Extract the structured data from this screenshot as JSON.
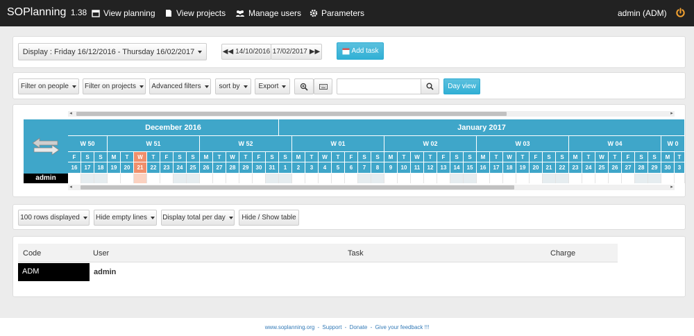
{
  "app": {
    "name": "SOPlanning",
    "version": "1.38"
  },
  "nav": [
    {
      "label": "View planning",
      "icon": "calendar-icon"
    },
    {
      "label": "View projects",
      "icon": "file-icon"
    },
    {
      "label": "Manage users",
      "icon": "users-icon"
    },
    {
      "label": "Parameters",
      "icon": "gear-icon"
    }
  ],
  "user_menu": "admin (ADM)",
  "toolbar1": {
    "display_label": "Display : Friday 16/12/2016 - Thursday 16/02/2017",
    "prev_date": "14/10/2016",
    "next_date": "17/02/2017",
    "add_task": "Add task"
  },
  "toolbar2": {
    "filter_people": "Filter on people",
    "filter_projects": "Filter on projects",
    "advanced_filters": "Advanced filters",
    "sort_by": "sort by",
    "export": "Export",
    "search_placeholder": "",
    "day_view": "Day view"
  },
  "planning": {
    "months": [
      {
        "label": "December 2016"
      },
      {
        "label": "January 2017"
      }
    ],
    "weeks": [
      "W 50",
      "W 51",
      "W 52",
      "W 01",
      "W 02",
      "W 03",
      "W 04",
      "W 0"
    ],
    "days": [
      {
        "dow": "F",
        "dom": "16"
      },
      {
        "dow": "S",
        "dom": "17"
      },
      {
        "dow": "S",
        "dom": "18"
      },
      {
        "dow": "M",
        "dom": "19"
      },
      {
        "dow": "T",
        "dom": "20"
      },
      {
        "dow": "W",
        "dom": "21"
      },
      {
        "dow": "T",
        "dom": "22"
      },
      {
        "dow": "F",
        "dom": "23"
      },
      {
        "dow": "S",
        "dom": "24"
      },
      {
        "dow": "S",
        "dom": "25"
      },
      {
        "dow": "M",
        "dom": "26"
      },
      {
        "dow": "T",
        "dom": "27"
      },
      {
        "dow": "W",
        "dom": "28"
      },
      {
        "dow": "T",
        "dom": "29"
      },
      {
        "dow": "F",
        "dom": "30"
      },
      {
        "dow": "S",
        "dom": "31"
      },
      {
        "dow": "S",
        "dom": "1"
      },
      {
        "dow": "M",
        "dom": "2"
      },
      {
        "dow": "T",
        "dom": "3"
      },
      {
        "dow": "W",
        "dom": "4"
      },
      {
        "dow": "T",
        "dom": "5"
      },
      {
        "dow": "F",
        "dom": "6"
      },
      {
        "dow": "S",
        "dom": "7"
      },
      {
        "dow": "S",
        "dom": "8"
      },
      {
        "dow": "M",
        "dom": "9"
      },
      {
        "dow": "T",
        "dom": "10"
      },
      {
        "dow": "W",
        "dom": "11"
      },
      {
        "dow": "T",
        "dom": "12"
      },
      {
        "dow": "F",
        "dom": "13"
      },
      {
        "dow": "S",
        "dom": "14"
      },
      {
        "dow": "S",
        "dom": "15"
      },
      {
        "dow": "M",
        "dom": "16"
      },
      {
        "dow": "T",
        "dom": "17"
      },
      {
        "dow": "W",
        "dom": "18"
      },
      {
        "dow": "T",
        "dom": "19"
      },
      {
        "dow": "F",
        "dom": "20"
      },
      {
        "dow": "S",
        "dom": "21"
      },
      {
        "dow": "S",
        "dom": "22"
      },
      {
        "dow": "M",
        "dom": "23"
      },
      {
        "dow": "T",
        "dom": "24"
      },
      {
        "dow": "W",
        "dom": "25"
      },
      {
        "dow": "T",
        "dom": "26"
      },
      {
        "dow": "F",
        "dom": "27"
      },
      {
        "dow": "S",
        "dom": "28"
      },
      {
        "dow": "S",
        "dom": "29"
      },
      {
        "dow": "M",
        "dom": "30"
      },
      {
        "dow": "T",
        "dom": "3"
      }
    ],
    "today_index": 5,
    "row_user": "admin"
  },
  "toolbar3": {
    "rows_displayed": "100 rows displayed",
    "hide_empty": "Hide empty lines",
    "display_total": "Display total per day",
    "hide_show_table": "Hide / Show table"
  },
  "table": {
    "headers": [
      "Code",
      "User",
      "Task",
      "Charge"
    ],
    "rows": [
      {
        "code": "ADM",
        "user": "admin"
      }
    ]
  },
  "footer": [
    "www.soplanning.org",
    "Support",
    "Donate",
    "Give your feedback !!!"
  ],
  "colors": {
    "accent": "#3fa6c9",
    "today": "#f08f6b",
    "topbar": "#222222"
  }
}
